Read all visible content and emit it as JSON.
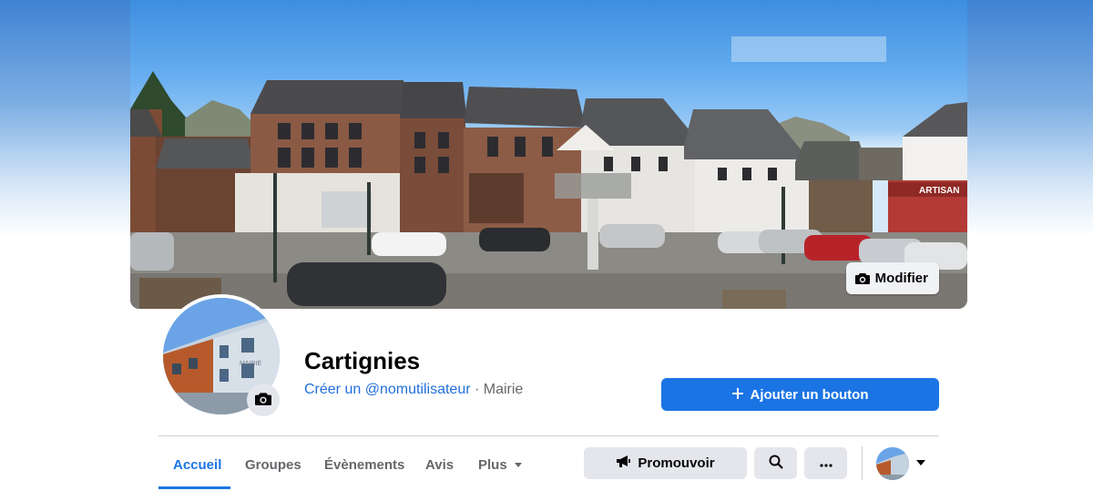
{
  "cover": {
    "edit_label": "Modifier",
    "shop_sign": "ARTISAN"
  },
  "profile": {
    "name": "Cartignies",
    "username_link": "Créer un @nomutilisateur",
    "separator": " · ",
    "category": "Mairie",
    "building_sign": "MAIRIE"
  },
  "actions": {
    "add_button_label": "Ajouter un bouton"
  },
  "tabs": [
    {
      "label": "Accueil",
      "active": true
    },
    {
      "label": "Groupes",
      "active": false
    },
    {
      "label": "Évènements",
      "active": false
    },
    {
      "label": "Avis",
      "active": false
    },
    {
      "label": "Plus",
      "active": false
    }
  ],
  "toolbar": {
    "promote_label": "Promouvoir"
  },
  "icons": {
    "camera": "camera-icon",
    "plus": "plus-icon",
    "megaphone": "megaphone-icon",
    "search": "search-icon",
    "more": "more-dots-icon",
    "caret": "caret-down-icon"
  },
  "colors": {
    "accent": "#1b74e4",
    "link": "#216fdb",
    "button_gray": "#e4e6eb",
    "text_secondary": "#65676b"
  }
}
